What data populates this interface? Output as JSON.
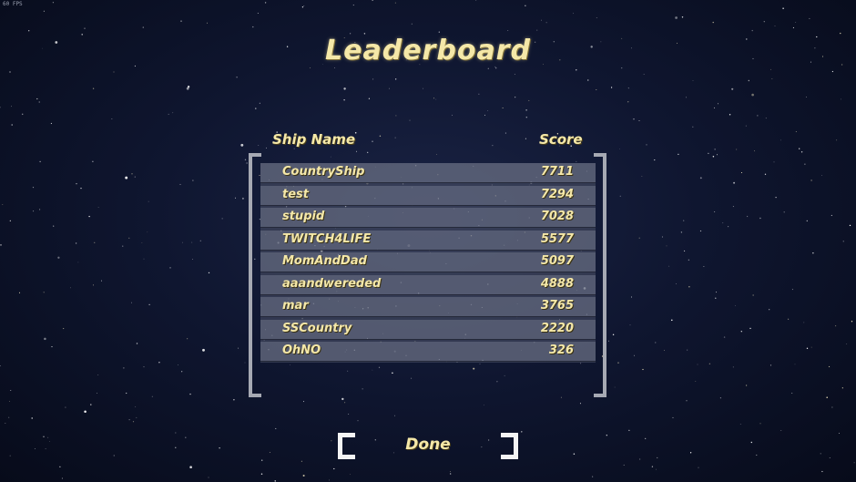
{
  "fps_counter": "60 FPS",
  "title": "Leaderboard",
  "columns": {
    "name": "Ship Name",
    "score": "Score"
  },
  "entries": [
    {
      "name": "CountryShip",
      "score": "7711"
    },
    {
      "name": "test",
      "score": "7294"
    },
    {
      "name": "stupid",
      "score": "7028"
    },
    {
      "name": "TWITCH4LIFE",
      "score": "5577"
    },
    {
      "name": "MomAndDad",
      "score": "5097"
    },
    {
      "name": "aaandwereded",
      "score": "4888"
    },
    {
      "name": "mar",
      "score": "3765"
    },
    {
      "name": "SSCountry",
      "score": "2220"
    },
    {
      "name": "OhNO",
      "score": "326"
    }
  ],
  "done_label": "Done",
  "colors": {
    "text": "#f5e8a8",
    "background": "#0f1630",
    "frame": "#a6a9b3"
  }
}
